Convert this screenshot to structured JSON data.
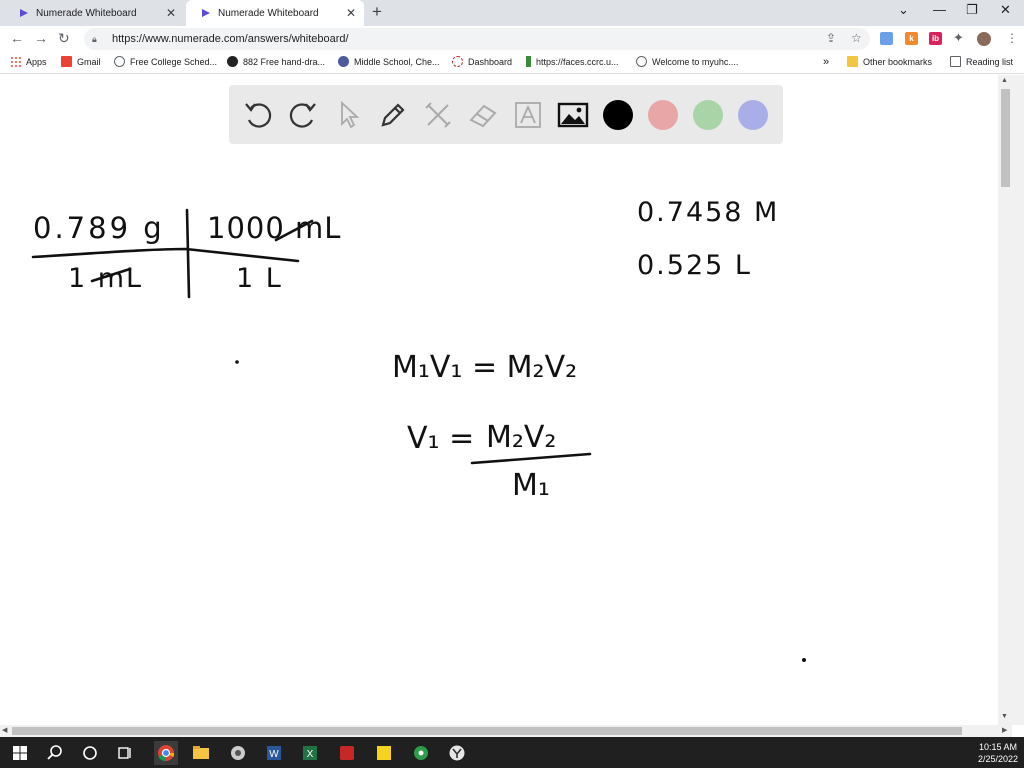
{
  "browser": {
    "tabs": [
      {
        "title": "Numerade Whiteboard",
        "active": false
      },
      {
        "title": "Numerade Whiteboard",
        "active": true
      }
    ],
    "new_tab_label": "+",
    "url": "https://www.numerade.com/answers/whiteboard/",
    "bookmarks": [
      {
        "label": "Apps",
        "icon": "apps-grid-icon"
      },
      {
        "label": "Gmail",
        "icon": "gmail-icon"
      },
      {
        "label": "Free College Sched...",
        "icon": "globe-icon"
      },
      {
        "label": "882 Free hand-dra...",
        "icon": "globe-icon"
      },
      {
        "label": "Middle School, Che...",
        "icon": "globe-icon"
      },
      {
        "label": "Dashboard",
        "icon": "dashboard-icon"
      },
      {
        "label": "https://faces.ccrc.u...",
        "icon": "faces-icon"
      },
      {
        "label": "Welcome to myuhc....",
        "icon": "globe-icon"
      }
    ],
    "bookmarks_overflow": "»",
    "other_bookmarks": "Other bookmarks",
    "reading_list": "Reading list"
  },
  "whiteboard": {
    "tools": [
      {
        "name": "undo-icon"
      },
      {
        "name": "redo-icon"
      },
      {
        "name": "pointer-icon"
      },
      {
        "name": "pen-icon"
      },
      {
        "name": "tools-icon"
      },
      {
        "name": "eraser-icon"
      },
      {
        "name": "text-tool-icon"
      },
      {
        "name": "image-icon"
      }
    ],
    "colors": [
      "#000000",
      "#e8a6a6",
      "#a8d4a8",
      "#a9aee8"
    ],
    "handwriting": {
      "conversion_top_left": "0.789 g",
      "conversion_top_right": "1000 mL",
      "conversion_bottom_left": "1 mL",
      "conversion_bottom_right": "1 L",
      "molarity": "0.7458 M",
      "volume": "0.525 L",
      "dilution_equation": "M₁V₁ = M₂V₂",
      "solved_lhs": "V₁ =",
      "solved_numerator": "M₂V₂",
      "solved_denominator": "M₁"
    }
  },
  "taskbar": {
    "time": "10:15 AM",
    "date": "2/25/2022"
  }
}
